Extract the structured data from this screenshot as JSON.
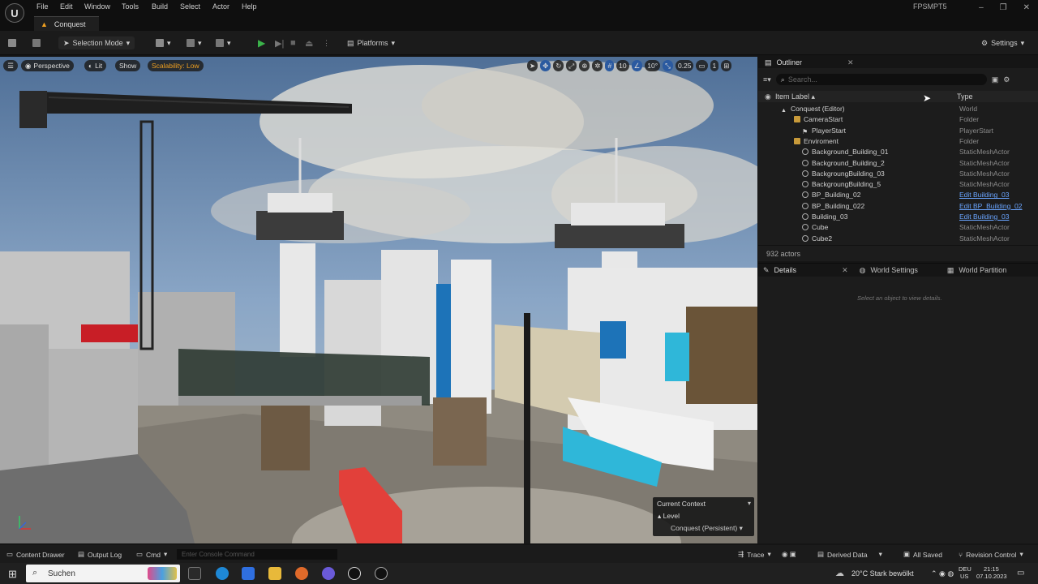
{
  "menu": {
    "items": [
      "File",
      "Edit",
      "Window",
      "Tools",
      "Build",
      "Select",
      "Actor",
      "Help"
    ],
    "project": "FPSMPT5"
  },
  "tab": {
    "label": "Conquest"
  },
  "toolbar": {
    "selection_mode": "Selection Mode",
    "platforms": "Platforms",
    "settings": "Settings"
  },
  "viewport": {
    "perspective": "Perspective",
    "lit": "Lit",
    "show": "Show",
    "scalability": "Scalability: Low",
    "grid_snap": "10",
    "rot_snap": "10°",
    "scale_snap": "0.25",
    "cam_speed": "1",
    "context": {
      "title": "Current Context",
      "level_label": "Level",
      "level_value": "Conquest (Persistent)"
    }
  },
  "outliner": {
    "title": "Outliner",
    "search_placeholder": "Search...",
    "col_label": "Item Label",
    "col_type": "Type",
    "rows": [
      {
        "label": "Conquest (Editor)",
        "type": "World"
      },
      {
        "label": "CameraStart",
        "type": "Folder"
      },
      {
        "label": "PlayerStart",
        "type": "PlayerStart"
      },
      {
        "label": "Enviroment",
        "type": "Folder"
      },
      {
        "label": "Background_Building_01",
        "type": "StaticMeshActor"
      },
      {
        "label": "Background_Building_2",
        "type": "StaticMeshActor"
      },
      {
        "label": "BackgroungBuilding_03",
        "type": "StaticMeshActor"
      },
      {
        "label": "BackgroungBuilding_5",
        "type": "StaticMeshActor"
      },
      {
        "label": "BP_Building_02",
        "type": "Edit Building_03"
      },
      {
        "label": "BP_Building_022",
        "type": "Edit BP_Building_02"
      },
      {
        "label": "Building_03",
        "type": "Edit Building_03"
      },
      {
        "label": "Cube",
        "type": "StaticMeshActor"
      },
      {
        "label": "Cube2",
        "type": "StaticMeshActor"
      }
    ],
    "count": "932 actors"
  },
  "details": {
    "tabs": [
      "Details",
      "World Settings",
      "World Partition"
    ],
    "empty": "Select an object to view details."
  },
  "statusbar": {
    "content_drawer": "Content Drawer",
    "output_log": "Output Log",
    "cmd": "Cmd",
    "console_placeholder": "Enter Console Command",
    "trace": "Trace",
    "derived_data": "Derived Data",
    "all_saved": "All Saved",
    "revision_control": "Revision Control"
  },
  "taskbar": {
    "search": "Suchen",
    "weather": "20°C  Stark bewölkt",
    "lang1": "DEU",
    "lang2": "US",
    "time": "21:15",
    "date": "07.10.2023"
  },
  "colors": {
    "accent_orange": "#f0a020",
    "play_green": "#3bb34a",
    "link_blue": "#6aa5ff"
  }
}
